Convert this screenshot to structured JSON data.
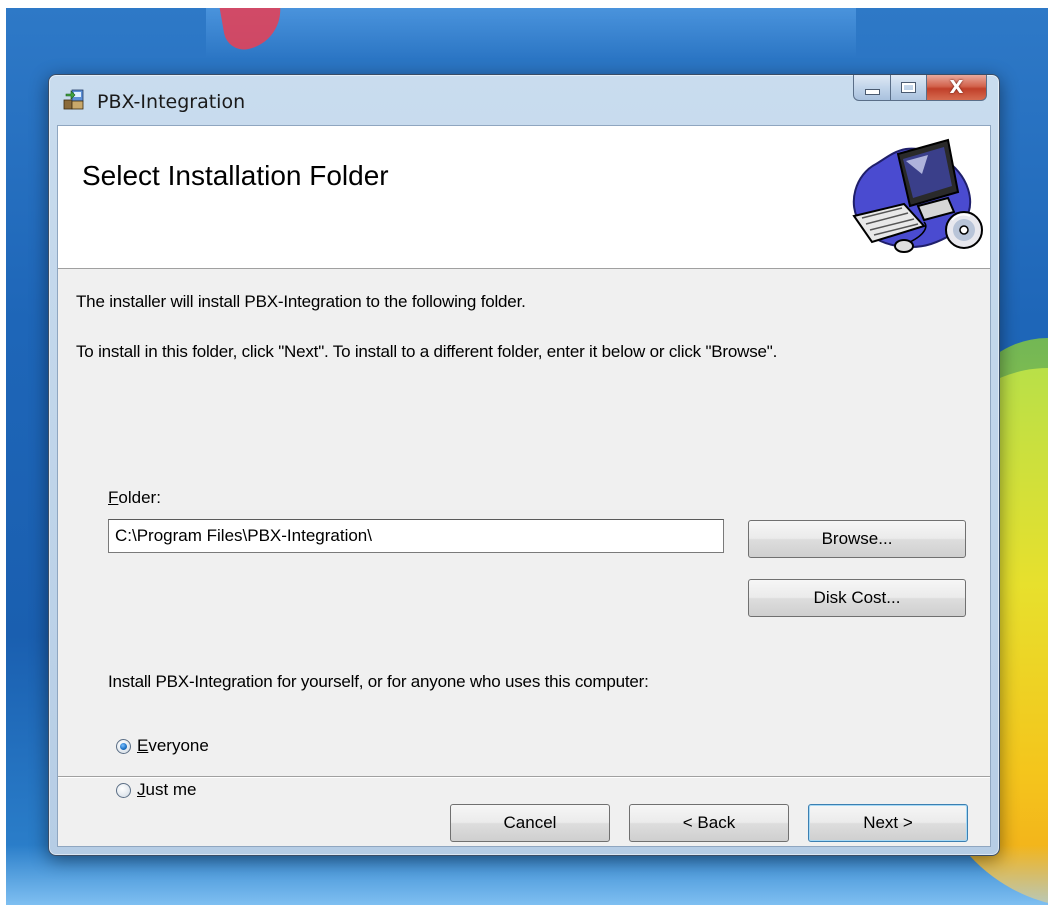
{
  "window": {
    "title": "PBX-Integration",
    "caption": {
      "close_glyph": "X"
    }
  },
  "banner": {
    "title": "Select Installation Folder",
    "image_icon": "computer-setup-icon"
  },
  "body": {
    "intro": "The installer will install PBX-Integration to the following folder.",
    "instructions": "To install in this folder, click \"Next\". To install to a different folder, enter it below or click \"Browse\".",
    "folder_label_mnemonic": "F",
    "folder_label_rest": "older:",
    "folder_value": "C:\\Program Files\\PBX-Integration\\",
    "browse_label": "Browse...",
    "disk_cost_label": "Disk Cost...",
    "install_for_prompt": "Install PBX-Integration for yourself, or for anyone who uses this computer:",
    "radio_options": [
      {
        "mnemonic": "E",
        "rest": "veryone",
        "selected": true
      },
      {
        "mnemonic": "J",
        "rest": "ust me",
        "selected": false
      }
    ]
  },
  "footer": {
    "cancel_label": "Cancel",
    "back_label": "< Back",
    "next_label": "Next >"
  },
  "colors": {
    "accent": "#3c7fb1",
    "close_button": "#c1402a",
    "desktop": "#1e66b8"
  }
}
